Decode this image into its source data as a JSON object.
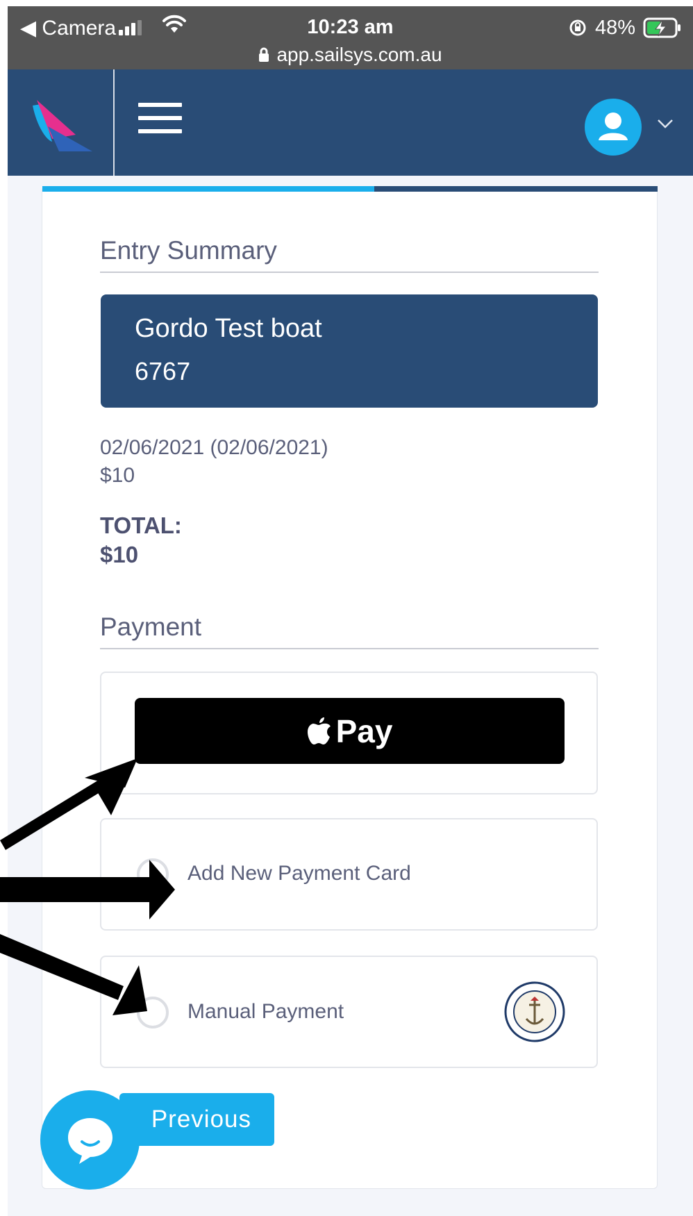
{
  "status_bar": {
    "back_label": "◀ Camera",
    "time": "10:23 am",
    "url": "app.sailsys.com.au",
    "battery": "48%"
  },
  "header": {
    "logo_icon": "sailsys-sail-logo",
    "menu_icon": "hamburger-menu-icon",
    "avatar_icon": "user-avatar-icon",
    "chevron_icon": "chevron-down-icon"
  },
  "progress": {
    "fraction": 0.54
  },
  "entry_summary": {
    "title": "Entry Summary",
    "boat_name": "Gordo Test boat",
    "sail_number": "6767",
    "date": "02/06/2021 (02/06/2021)",
    "price": "$10",
    "total_label": "TOTAL:",
    "total_value": "$10"
  },
  "payment": {
    "title": "Payment",
    "apple_pay_label": "Pay",
    "options": [
      {
        "label": "Add New Payment Card"
      },
      {
        "label": "Manual Payment"
      }
    ]
  },
  "footer": {
    "previous_label": "Previous"
  },
  "colors": {
    "navy": "#294c76",
    "accent": "#1aaeeb",
    "text": "#5a5f7a"
  }
}
